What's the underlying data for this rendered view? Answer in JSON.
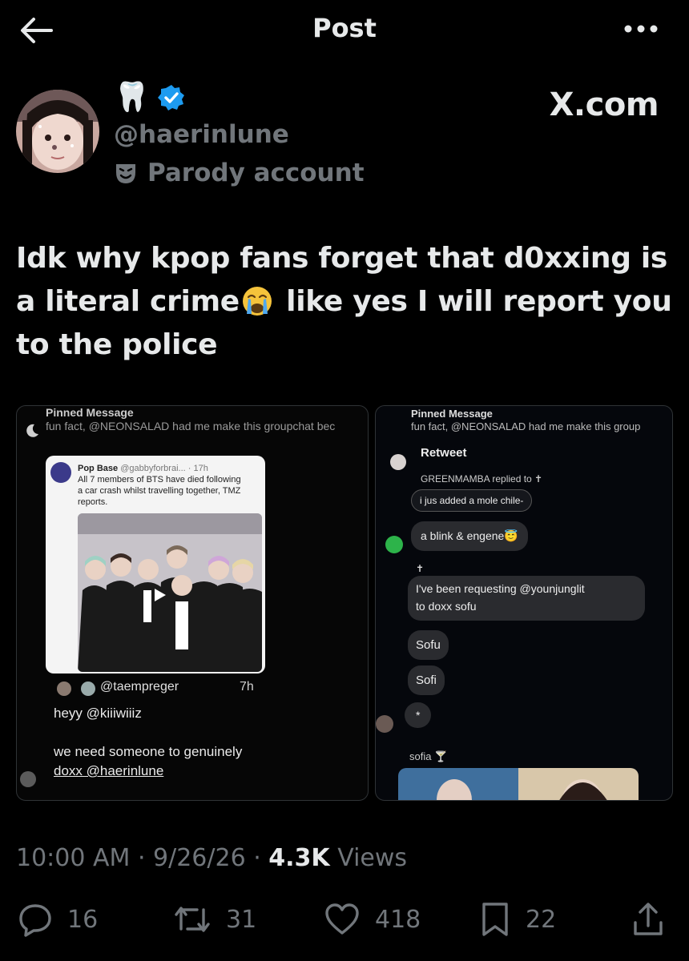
{
  "header": {
    "title": "Post"
  },
  "author": {
    "name_emoji": "🦷",
    "handle": "@haerinlune",
    "parody_label": "Parody account",
    "watermark": "X.com"
  },
  "tweet": {
    "text_part1": "Idk why kpop fans forget that d0xxing is a literal crime",
    "text_part2": " like yes I will report you to the police"
  },
  "media": {
    "left": {
      "pinned_title": "Pinned Message",
      "pinned_text": "fun fact, @NEONSALAD had me make this groupchat bec",
      "quote_source": "Pop Base",
      "quote_handle": "@gabbyforbrai...",
      "quote_time": "· 17h",
      "quote_body_1": "All 7 members of BTS have died following",
      "quote_body_2": "a car crash whilst travelling together, TMZ",
      "quote_body_3": "reports.",
      "reply_handle": "@taempreger",
      "reply_time": "7h",
      "message_1": "heyy @kiiiwiiiz",
      "message_2_line1": "we need someone to genuinely",
      "message_2_line2": "doxx @haerinlune"
    },
    "right": {
      "pinned_title": "Pinned Message",
      "pinned_text": "fun fact, @NEONSALAD had me make this group",
      "retweet_label": "Retweet",
      "replied_label": "GREENMAMBA replied to ✝",
      "quoted_msg": "i jus added a mole chile-",
      "msg_1": "a blink & engene😇",
      "cross": "✝",
      "msg_2_line1": "I've been requesting @younjunglit",
      "msg_2_line2": "to doxx sofu",
      "msg_3": "Sofu",
      "msg_4": "Sofi",
      "msg_5": "*",
      "sender_name": "sofia",
      "sender_emoji": "🍸"
    }
  },
  "meta": {
    "time": "10:00 AM",
    "date": "9/26/26",
    "views_count": "4.3K",
    "views_label": "Views",
    "separator": " · "
  },
  "actions": {
    "replies": "16",
    "reposts": "31",
    "likes": "418",
    "bookmarks": "22"
  },
  "colors": {
    "verified": "#1d9bf0",
    "muted": "#71767b",
    "text": "#e7e9ea"
  }
}
